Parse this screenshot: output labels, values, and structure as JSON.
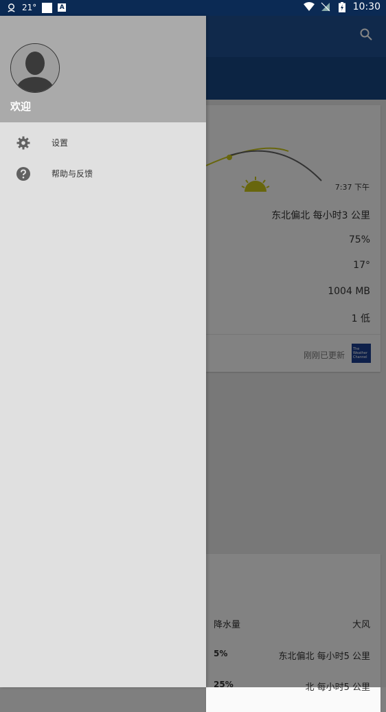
{
  "status_bar": {
    "temperature": "21°",
    "a_badge": "A",
    "time": "10:30"
  },
  "drawer": {
    "welcome": "欢迎",
    "items": [
      {
        "label": "设置",
        "icon": "gear-icon"
      },
      {
        "label": "帮助与反馈",
        "icon": "help-icon"
      }
    ]
  },
  "weather_card": {
    "sunset_time": "7:37 下午",
    "wind": "东北偏北 每小时3 公里",
    "humidity": "75%",
    "dew_point": "17°",
    "pressure": "1004 MB",
    "uv_index": "1 低",
    "updated": "刚刚已更新",
    "brand_lines": [
      "The",
      "Weather",
      "Channel"
    ]
  },
  "forecast_card": {
    "col_precip": "降水量",
    "col_wind": "大风",
    "rows": [
      {
        "precip": "5%",
        "wind": "东北偏北 每小时5 公里"
      },
      {
        "precip": "25%",
        "wind": "北 每小时5 公里"
      }
    ]
  },
  "colors": {
    "status_bar": "#0b2a54",
    "toolbar": "#1f4f90",
    "drawer_header": "#aaaaaa",
    "drawer_bg": "#e0e0e0"
  }
}
